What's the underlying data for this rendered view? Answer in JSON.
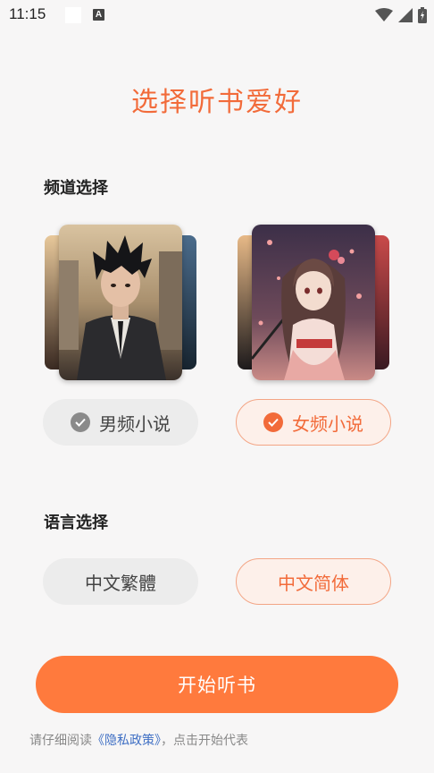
{
  "status_bar": {
    "time": "11:15",
    "notification_letter": "A",
    "icons": [
      "wifi-icon",
      "signal-icon",
      "battery-icon"
    ]
  },
  "page": {
    "title": "选择听书爱好"
  },
  "channel_section": {
    "label": "频道选择",
    "options": [
      {
        "label": "男频小说",
        "selected": false,
        "cover": "male-novel-cover"
      },
      {
        "label": "女频小说",
        "selected": true,
        "cover": "female-novel-cover"
      }
    ]
  },
  "language_section": {
    "label": "语言选择",
    "options": [
      {
        "label": "中文繁體",
        "selected": false
      },
      {
        "label": "中文简体",
        "selected": true
      }
    ]
  },
  "start_button": {
    "label": "开始听书"
  },
  "notice": {
    "prefix": "请仔细阅读",
    "link": "《隐私政策》",
    "suffix": "，点击开始代表"
  },
  "colors": {
    "accent": "#f26b3a",
    "button": "#ff7a3d",
    "selected_bg": "#fdf0ea",
    "unselected_bg": "#ececec",
    "link": "#3f6fc4"
  }
}
